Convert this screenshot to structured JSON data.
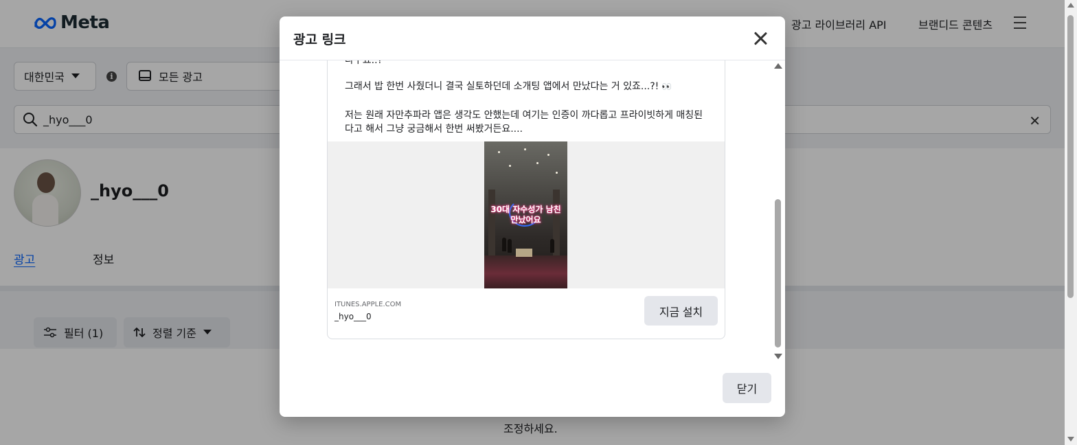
{
  "header": {
    "logo_text": "Meta",
    "nav_links": [
      "광고 라이브러리 API",
      "브랜디드 콘텐츠"
    ]
  },
  "filters": {
    "country": "대한민국",
    "ad_type": "모든 광고",
    "search_value": "_hyo___0"
  },
  "profile": {
    "name": "_hyo___0",
    "tabs": [
      "광고",
      "정보"
    ]
  },
  "toolbar": {
    "filter_label": "필터 (1)",
    "sort_label": "정렬 기준"
  },
  "background_hint": "조정하세요.",
  "modal": {
    "title": "광고 링크",
    "ad_text": [
      "라구요..?",
      "그래서 밥 한번 사줬더니 결국 실토하던데 소개팅 앱에서 만났다는 거 있죠...?!",
      "저는 원래 자만추파라 앱은 생각도 안했는데 여기는 인증이 까다롭고 프라이빗하게 매칭된다고 해서 그냥 궁금해서 한번 써봤거든요...."
    ],
    "eyes_emoji": "👀",
    "media_overlay_text": [
      "30대 자수성가 남친",
      "만났어요"
    ],
    "footer_domain": "ITUNES.APPLE.COM",
    "footer_name": "_hyo___0",
    "install_button": "지금 설치",
    "close_button": "닫기"
  },
  "colors": {
    "link_blue": "#0866ff",
    "button_gray": "#e4e6eb",
    "overlay_text_glow": "#ff3d8b"
  }
}
